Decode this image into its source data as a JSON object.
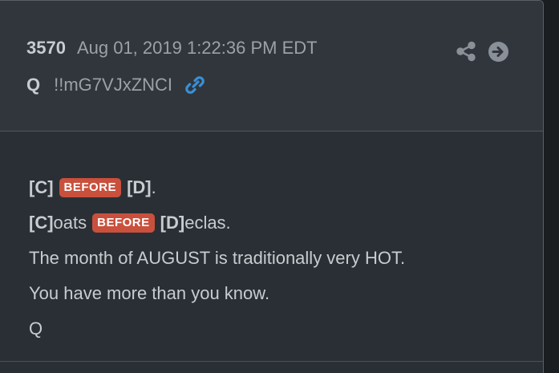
{
  "post": {
    "number": "3570",
    "date": "Aug 01, 2019 1:22:36 PM EDT",
    "author": "Q",
    "tripcode": "!!mG7VJxZNCI"
  },
  "icons": {
    "link": "link-icon",
    "share": "share-icon",
    "next": "arrow-circle-right-icon"
  },
  "colors": {
    "badge": "#c9503c",
    "link": "#3a8fd6",
    "card": "#2a2f35",
    "header": "#30363c"
  },
  "body": {
    "line1": {
      "a": "[C]",
      "badge": "BEFORE",
      "b": "[D]",
      "tail": "."
    },
    "line2": {
      "a": "[C]",
      "a_rest": "oats",
      "badge": "BEFORE",
      "b": "[D]",
      "b_rest": "eclas."
    },
    "line3": "The month of AUGUST is traditionally very HOT.",
    "line4": "You have more than you know.",
    "line5": "Q"
  }
}
